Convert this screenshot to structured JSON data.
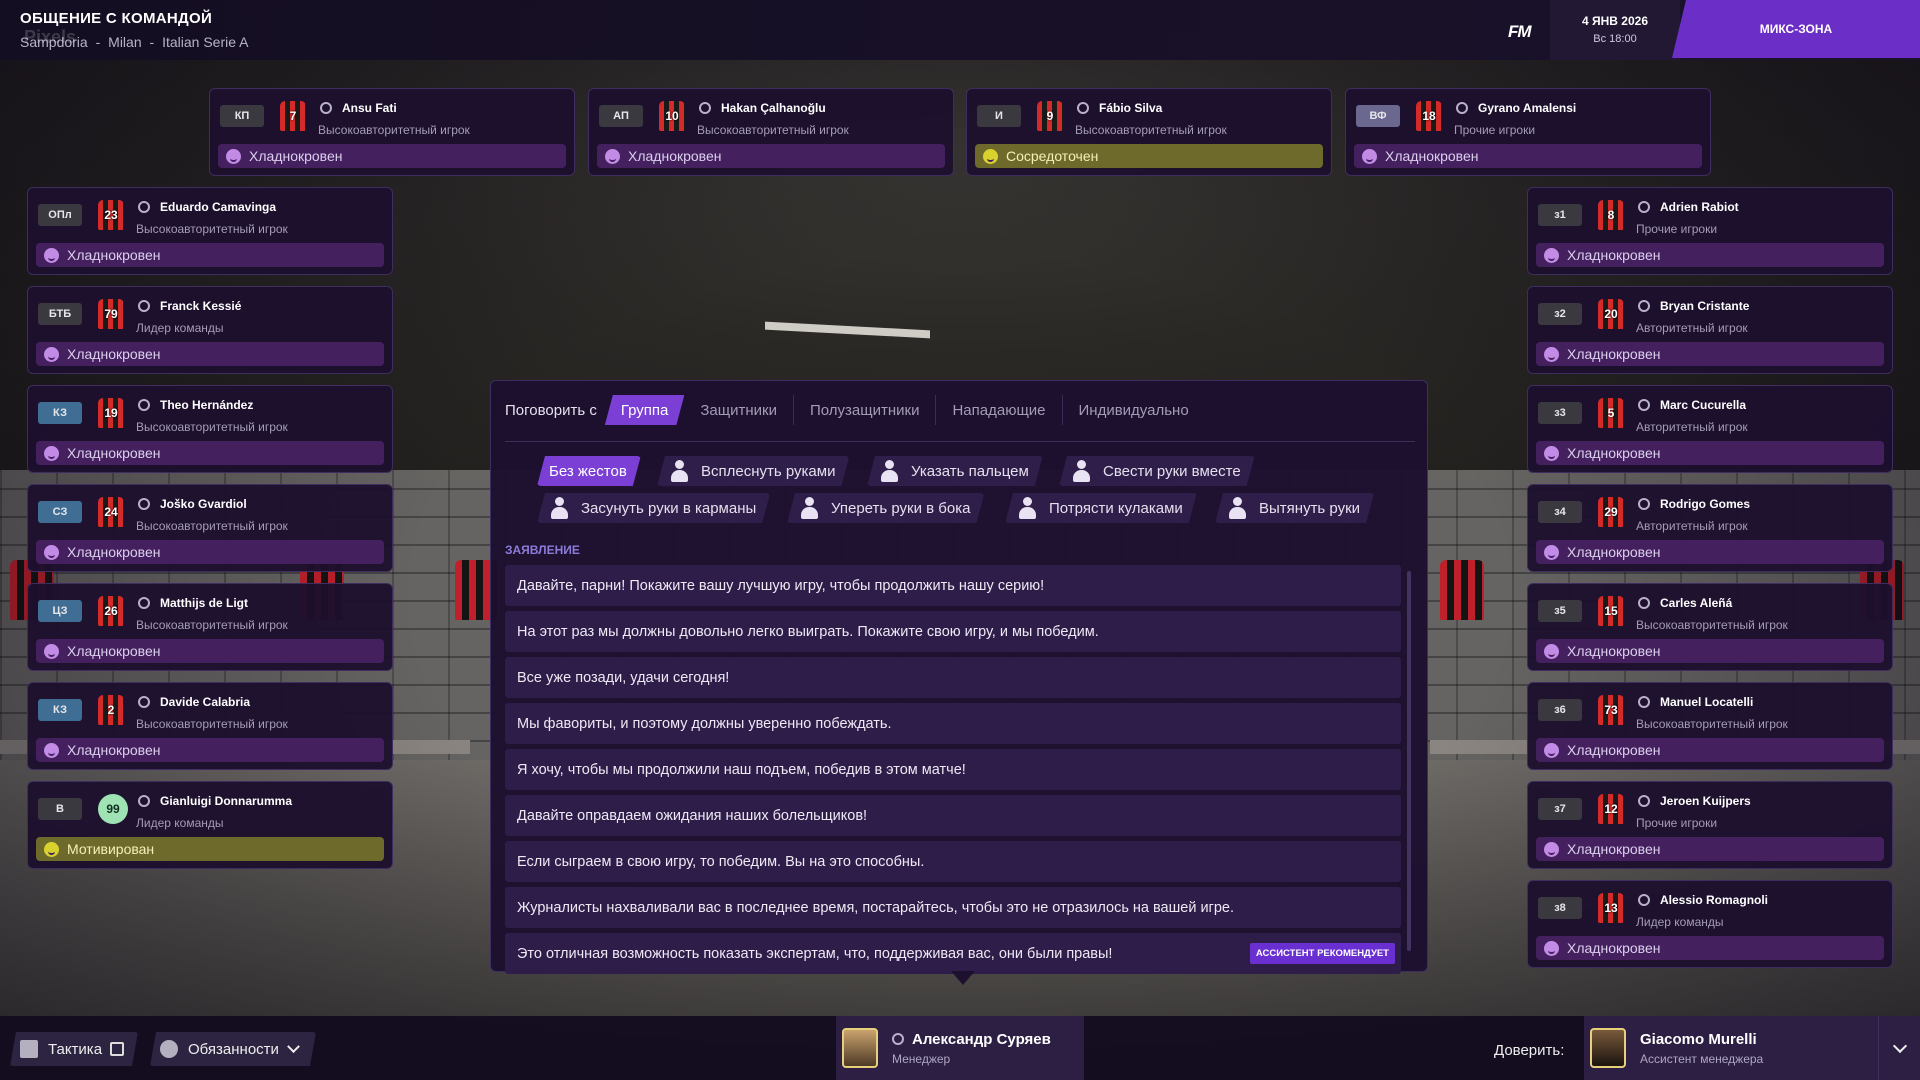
{
  "header": {
    "title": "ОБЩЕНИЕ С КОМАНДОЙ",
    "breadcrumbs": [
      "Sampdoria",
      "-",
      "Milan",
      "-",
      "Italian Serie A"
    ],
    "logo": "FM",
    "date": "4 ЯНВ 2026",
    "time": "Вс 18:00",
    "mix_zone": "МИКС-ЗОНА"
  },
  "top_players": [
    {
      "pos": "КП",
      "num": "7",
      "name": "Ansu Fati",
      "role": "Высокоавторитетный игрок",
      "mood": "Хладнокровен",
      "mood_type": "calm"
    },
    {
      "pos": "АП",
      "num": "10",
      "name": "Hakan Çalhanoğlu",
      "role": "Высокоавторитетный игрок",
      "mood": "Хладнокровен",
      "mood_type": "calm"
    },
    {
      "pos": "И",
      "num": "9",
      "name": "Fábio Silva",
      "role": "Высокоавторитетный игрок",
      "mood": "Сосредоточен",
      "mood_type": "focused"
    },
    {
      "pos": "ВФ",
      "num": "18",
      "name": "Gyrano Amalensi",
      "role": "Прочие игроки",
      "mood": "Хладнокровен",
      "mood_type": "calm"
    }
  ],
  "left_players": [
    {
      "pos": "ОПл",
      "num": "23",
      "name": "Eduardo Camavinga",
      "role": "Высокоавторитетный игрок",
      "mood": "Хладнокровен"
    },
    {
      "pos": "БТБ",
      "num": "79",
      "name": "Franck Kessié",
      "role": "Лидер команды",
      "mood": "Хладнокровен"
    },
    {
      "pos": "КЗ",
      "num": "19",
      "name": "Theo Hernández",
      "role": "Высокоавторитетный игрок",
      "mood": "Хладнокровен"
    },
    {
      "pos": "СЗ",
      "num": "24",
      "name": "Joško Gvardiol",
      "role": "Высокоавторитетный игрок",
      "mood": "Хладнокровен"
    },
    {
      "pos": "ЦЗ",
      "num": "26",
      "name": "Matthijs de Ligt",
      "role": "Высокоавторитетный игрок",
      "mood": "Хладнокровен"
    },
    {
      "pos": "КЗ",
      "num": "2",
      "name": "Davide Calabria",
      "role": "Высокоавторитетный игрок",
      "mood": "Хладнокровен"
    },
    {
      "pos": "В",
      "num": "99",
      "name": "Gianluigi Donnarumma",
      "role": "Лидер команды",
      "mood": "Мотивирован"
    }
  ],
  "right_players": [
    {
      "pos": "з1",
      "num": "8",
      "name": "Adrien Rabiot",
      "role": "Прочие игроки",
      "mood": "Хладнокровен"
    },
    {
      "pos": "з2",
      "num": "20",
      "name": "Bryan Cristante",
      "role": "Авторитетный игрок",
      "mood": "Хладнокровен"
    },
    {
      "pos": "з3",
      "num": "5",
      "name": "Marc Cucurella",
      "role": "Авторитетный игрок",
      "mood": "Хладнокровен"
    },
    {
      "pos": "з4",
      "num": "29",
      "name": "Rodrigo Gomes",
      "role": "Авторитетный игрок",
      "mood": "Хладнокровен"
    },
    {
      "pos": "з5",
      "num": "15",
      "name": "Carles Aleñá",
      "role": "Высокоавторитетный игрок",
      "mood": "Хладнокровен"
    },
    {
      "pos": "з6",
      "num": "73",
      "name": "Manuel Locatelli",
      "role": "Высокоавторитетный игрок",
      "mood": "Хладнокровен"
    },
    {
      "pos": "з7",
      "num": "12",
      "name": "Jeroen Kuijpers",
      "role": "Прочие игроки",
      "mood": "Хладнокровен"
    },
    {
      "pos": "з8",
      "num": "13",
      "name": "Alessio Romagnoli",
      "role": "Лидер команды",
      "mood": "Хладнокровен"
    }
  ],
  "talk": {
    "talk_to_label": "Поговорить с",
    "tabs": [
      "Группа",
      "Защитники",
      "Полузащитники",
      "Нападающие",
      "Индивидуально"
    ],
    "active_tab": "Группа",
    "gestures": [
      "Без жестов",
      "Всплеснуть руками",
      "Указать пальцем",
      "Свести руки вместе",
      "Засунуть руки в карманы",
      "Упереть руки в бока",
      "Потрясти кулаками",
      "Вытянуть руки"
    ],
    "active_gesture": "Без жестов",
    "statement_label": "ЗАЯВЛЕНИЕ",
    "statements": [
      "Давайте, парни! Покажите вашу лучшую игру, чтобы продолжить нашу серию!",
      "На этот раз мы должны довольно легко выиграть. Покажите свою игру, и мы победим.",
      "Все уже позади, удачи сегодня!",
      "Мы фавориты, и поэтому должны уверенно побеждать.",
      "Я хочу, чтобы мы продолжили наш подъем, победив в этом матче!",
      "Давайте оправдаем ожидания наших болельщиков!",
      "Если сыграем в свою игру, то победим. Вы на это способны.",
      "Журналисты нахваливали вас в последнее время, постарайтесь, чтобы это не отразилось на вашей игре.",
      "Это отличная возможность показать экспертам, что, поддерживая вас, они были правы!"
    ],
    "recommend_badge": "АССИСТЕНТ РЕКОМЕНДУЕТ"
  },
  "bottom": {
    "tactics": "Тактика",
    "duties": "Обязанности",
    "manager_name": "Александр Суряев",
    "manager_role": "Менеджер",
    "trust_label": "Доверить:",
    "assistant_name": "Giacomo Murelli",
    "assistant_role": "Ассистент менеджера"
  }
}
